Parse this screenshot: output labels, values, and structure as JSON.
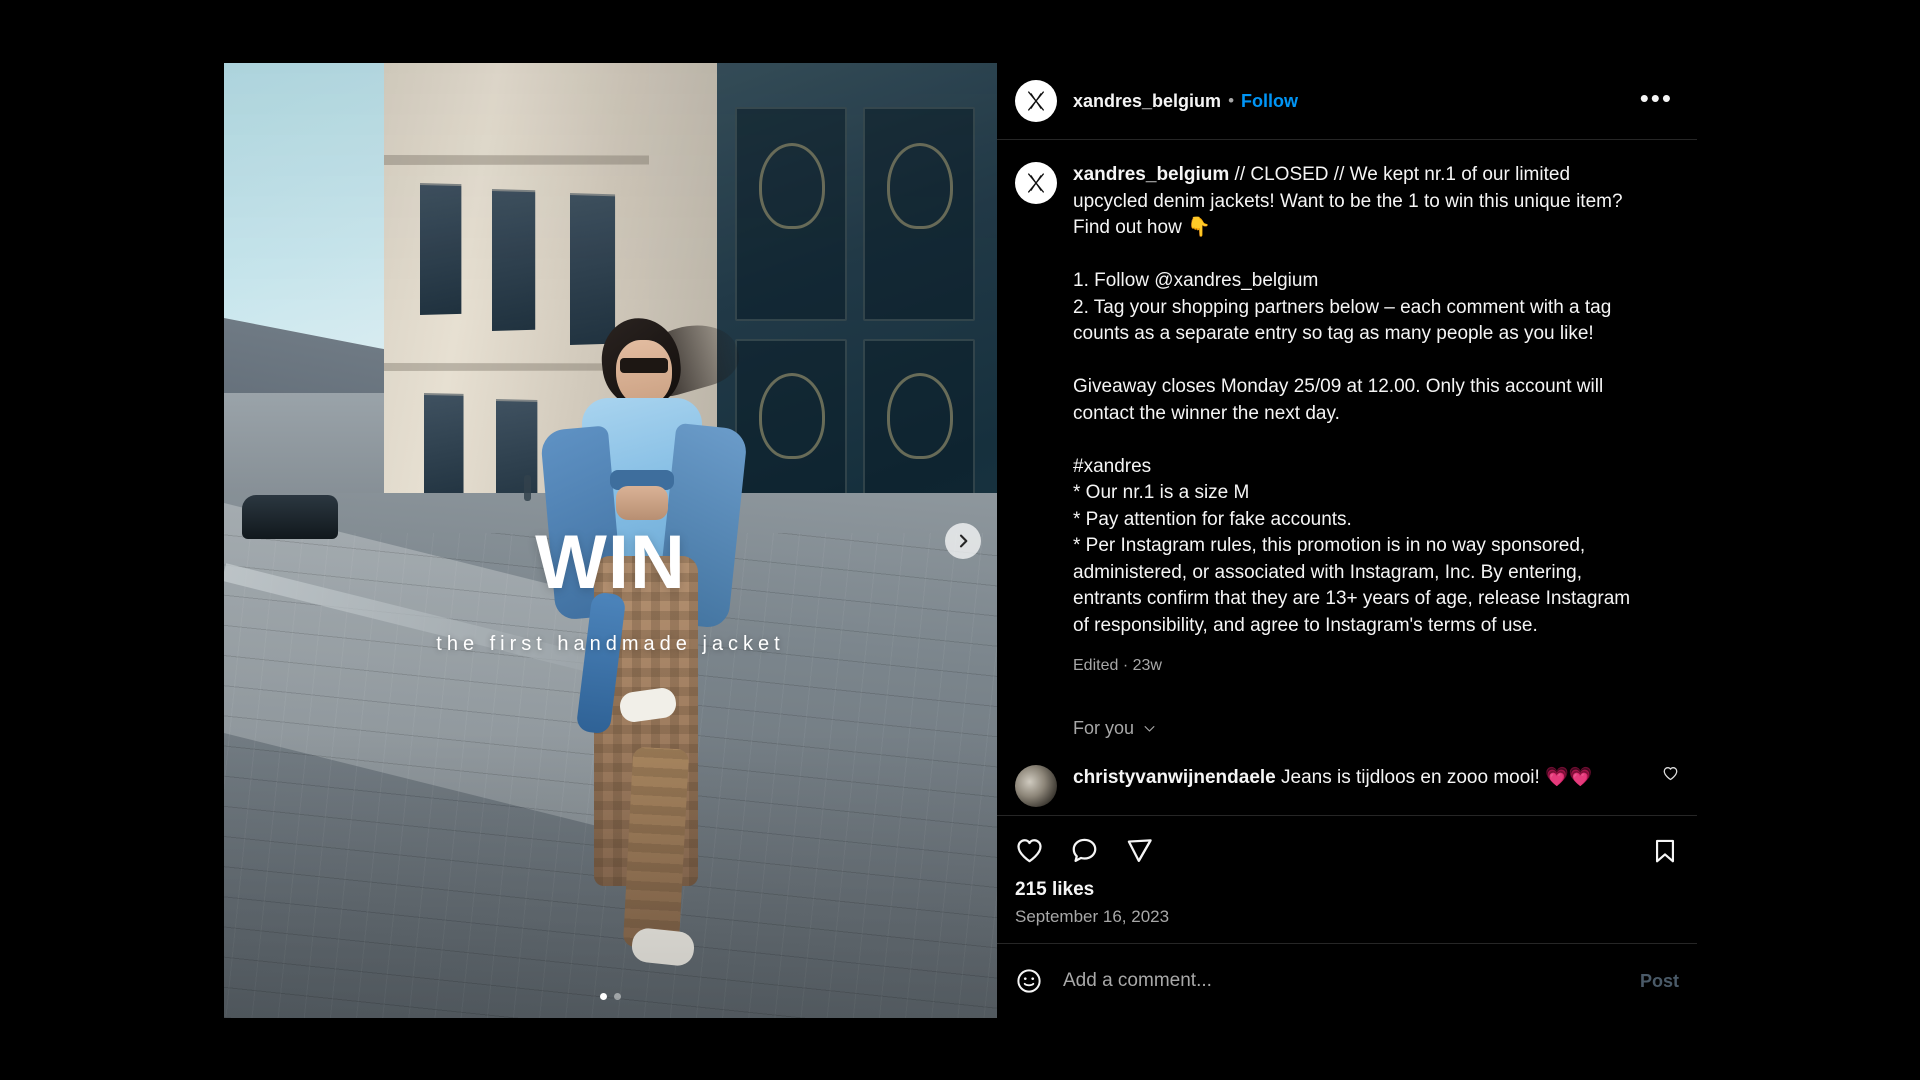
{
  "header": {
    "username": "xandres_belgium",
    "separator": "•",
    "follow_label": "Follow",
    "more_label": "•••",
    "avatar_icon": "xandres-x-logo",
    "follow_color": "#0095f6"
  },
  "media": {
    "overlay_title": "WIN",
    "overlay_subtitle": "the first handmade jacket",
    "next_button_icon": "chevron-right-icon",
    "carousel_dots": 2,
    "carousel_active_index": 0
  },
  "caption": {
    "username": "xandres_belgium",
    "paragraphs": [
      " // CLOSED // We kept nr.1 of our limited upcycled denim jackets! Want to be the 1 to win this unique item? Find out how 👇",
      "1. Follow @xandres_belgium\n2. Tag your shopping partners below – each comment with a tag counts as a separate entry so tag as many people as you like!",
      "Giveaway closes Monday 25/09 at 12.00. Only this account will contact the winner the next day.",
      "#xandres\n* Our nr.1 is a size M\n* Pay attention for fake accounts.\n* Per Instagram rules, this promotion is in no way sponsored, administered, or associated with Instagram, Inc. By entering, entrants confirm that they are 13+ years of age, release Instagram of responsibility, and agree to Instagram's terms of use."
    ],
    "meta": "Edited · 23w"
  },
  "comments": {
    "filter_label": "For you",
    "filter_icon": "chevron-down-icon",
    "items": [
      {
        "username": "christyvanwijnendaele",
        "text": " Jeans is tijdloos en zooo mooi! 💗💗",
        "like_icon": "heart-icon"
      }
    ]
  },
  "actions": {
    "like_icon": "heart-icon",
    "comment_icon": "comment-bubble-icon",
    "share_icon": "share-paper-plane-icon",
    "save_icon": "bookmark-icon"
  },
  "stats": {
    "likes": "215 likes",
    "date": "September 16, 2023"
  },
  "compose": {
    "emoji_icon": "emoji-smiley-icon",
    "placeholder": "Add a comment...",
    "post_label": "Post"
  }
}
